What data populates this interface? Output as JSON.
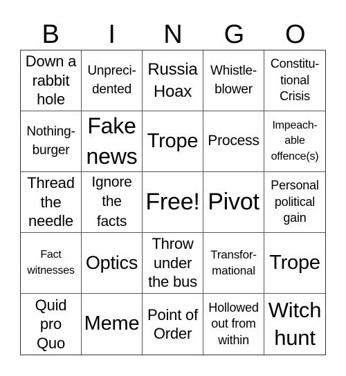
{
  "header": [
    "B",
    "I",
    "N",
    "G",
    "O"
  ],
  "cells": [
    "Down a\nrabbit\nhole",
    "Unpreci-\ndented",
    "Russia\nHoax",
    "Whistle-\nblower",
    "Constitu-\ntional\nCrisis",
    "Nothing-\nburger",
    "Fake\nnews",
    "Trope",
    "Process",
    "Impeach-\nable\noffence(s)",
    "Thread\nthe\nneedle",
    "Ignore\nthe\nfacts",
    "Free!",
    "Pivot",
    "Personal\npolitical\ngain",
    "Fact\nwitnesses",
    "Optics",
    "Throw\nunder\nthe bus",
    "Transfor-\nmational",
    "Trope",
    "Quid\npro\nQuo",
    "Meme",
    "Point of\nOrder",
    "Hollowed\nout from\nwithin",
    "Witch\nhunt"
  ]
}
